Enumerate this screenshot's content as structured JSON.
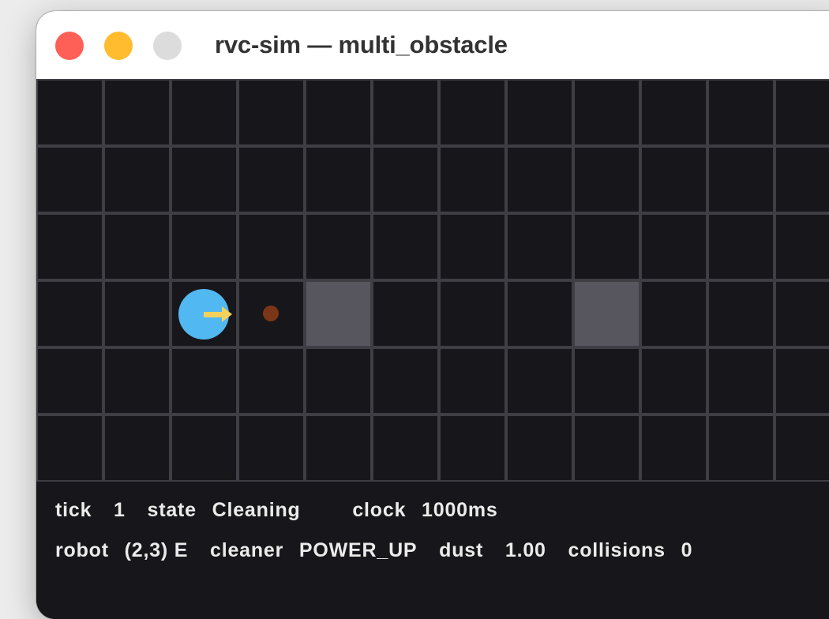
{
  "window": {
    "title": "rvc-sim — multi_obstacle"
  },
  "grid": {
    "cols": 12,
    "rows": 6,
    "visible_cols": 12,
    "obstacles": [
      {
        "col": 4,
        "row": 3
      },
      {
        "col": 8,
        "row": 3
      }
    ],
    "robot": {
      "col": 2,
      "row": 3,
      "heading": "E"
    },
    "dust": [
      {
        "col": 3,
        "row": 3
      }
    ],
    "colors": {
      "background": "#17161a",
      "grid_line": "#3f3e44",
      "obstacle": "#57565f",
      "robot": "#51b8f2",
      "heading": "#f3d15c",
      "dust": "#7b3517"
    }
  },
  "status": {
    "tick_label": "tick",
    "tick_value": "1",
    "state_label": "state",
    "state_value": "Cleaning",
    "clock_label": "clock",
    "clock_value": "1000ms",
    "robot_label": "robot",
    "robot_value": "(2,3) E",
    "cleaner_label": "cleaner",
    "cleaner_value": "POWER_UP",
    "dust_label": "dust",
    "dust_value": "1.00",
    "collisions_label": "collisions",
    "collisions_value": "0"
  }
}
